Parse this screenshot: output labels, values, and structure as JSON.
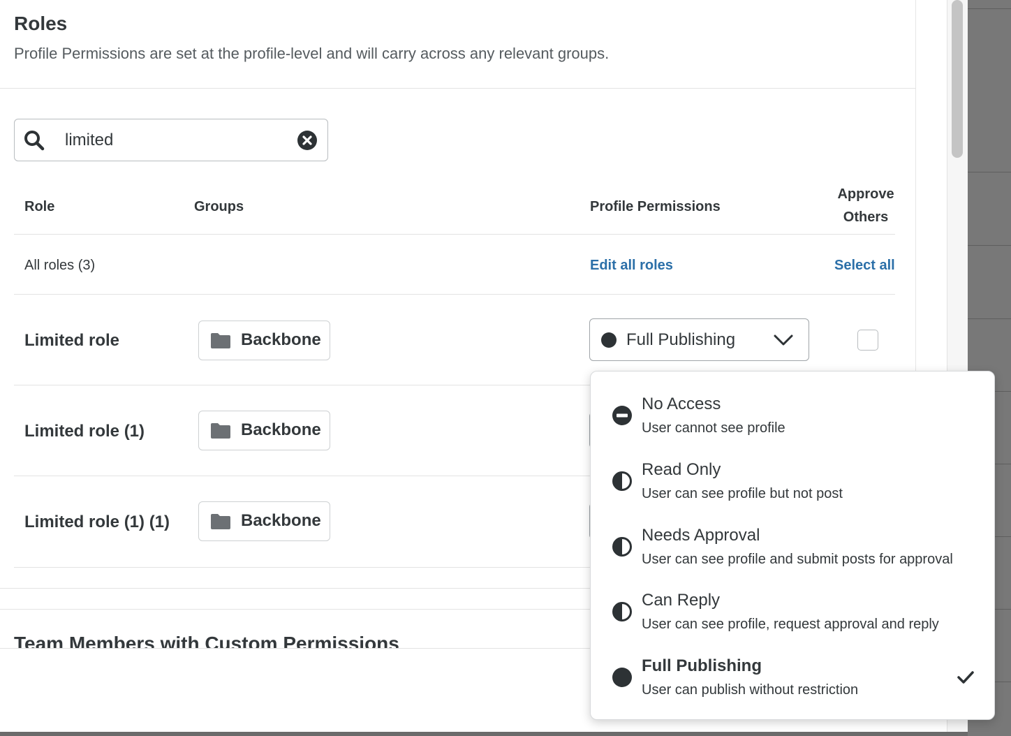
{
  "header": {
    "title": "Roles",
    "subtitle": "Profile Permissions are set at the profile-level and will carry across any relevant groups."
  },
  "search": {
    "value": "limited"
  },
  "table": {
    "columns": {
      "role": "Role",
      "groups": "Groups",
      "profile_permissions": "Profile Permissions",
      "approve_others": "Approve Others"
    },
    "all_roles_label": "All roles (3)",
    "edit_all_label": "Edit all roles",
    "select_all_label": "Select all",
    "rows": [
      {
        "role": "Limited role",
        "group": "Backbone",
        "permission": "Full Publishing"
      },
      {
        "role": "Limited role (1)",
        "group": "Backbone"
      },
      {
        "role": "Limited role (1) (1)",
        "group": "Backbone"
      }
    ]
  },
  "section2": {
    "title": "Team Members with Custom Permissions"
  },
  "dropdown": {
    "options": [
      {
        "title": "No Access",
        "desc": "User cannot see profile",
        "icon": "no-access-icon"
      },
      {
        "title": "Read Only",
        "desc": "User can see profile but not post",
        "icon": "half-circle-icon"
      },
      {
        "title": "Needs Approval",
        "desc": "User can see profile and submit posts for approval",
        "icon": "half-circle-icon"
      },
      {
        "title": "Can Reply",
        "desc": "User can see profile, request approval and reply",
        "icon": "half-circle-icon"
      },
      {
        "title": "Full Publishing",
        "desc": "User can publish without restriction",
        "icon": "full-circle-icon",
        "selected": true
      }
    ]
  },
  "colors": {
    "link": "#2b6fa8",
    "text": "#33383b",
    "icon_dark": "#2d3235"
  }
}
